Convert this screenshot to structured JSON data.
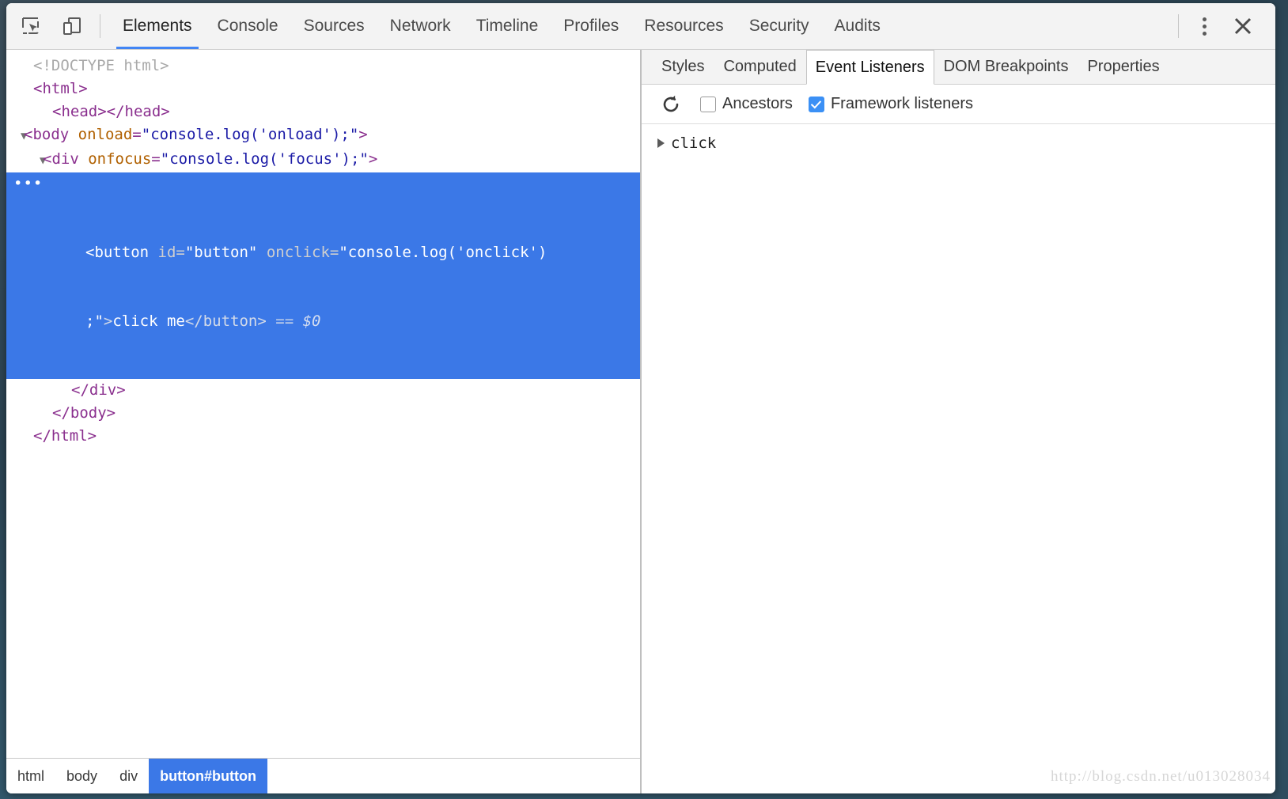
{
  "toolbar": {
    "inspect_icon": "inspect-element-icon",
    "device_icon": "device-toolbar-icon",
    "menu_icon": "more-options-icon",
    "close_icon": "close-icon",
    "tabs": [
      {
        "label": "Elements",
        "active": true
      },
      {
        "label": "Console",
        "active": false
      },
      {
        "label": "Sources",
        "active": false
      },
      {
        "label": "Network",
        "active": false
      },
      {
        "label": "Timeline",
        "active": false
      },
      {
        "label": "Profiles",
        "active": false
      },
      {
        "label": "Resources",
        "active": false
      },
      {
        "label": "Security",
        "active": false
      },
      {
        "label": "Audits",
        "active": false
      }
    ]
  },
  "dom_tree": {
    "rows": {
      "doctype": "<!DOCTYPE html>",
      "html_open": "<html>",
      "head": "<head></head>",
      "body_tag": "<body",
      "body_attr_name": "onload",
      "body_attr_value": "\"console.log('onload');\"",
      "body_close_bracket": ">",
      "div_tag": "<div",
      "div_attr_name": "onfocus",
      "div_attr_value": "\"console.log('focus');\"",
      "div_close_bracket": ">",
      "sel_ellipsis": "•••",
      "sel_button_tag": "<button",
      "sel_id_name": "id=",
      "sel_id_value": "\"button\"",
      "sel_onclick_name": "onclick=",
      "sel_onclick_value_line1": "\"console.log('onclick')",
      "sel_onclick_value_line2": ";\"",
      "sel_gt": ">",
      "sel_text": "click me",
      "sel_close_tag": "</button>",
      "sel_eq": "==",
      "sel_dollar": "$0",
      "div_close": "</div>",
      "body_close": "</body>",
      "html_close": "</html>"
    }
  },
  "breadcrumb": {
    "items": [
      {
        "label": "html",
        "active": false
      },
      {
        "label": "body",
        "active": false
      },
      {
        "label": "div",
        "active": false
      },
      {
        "label": "button#button",
        "active": true
      }
    ]
  },
  "sidebar": {
    "tabs": [
      {
        "label": "Styles",
        "active": false
      },
      {
        "label": "Computed",
        "active": false
      },
      {
        "label": "Event Listeners",
        "active": true
      },
      {
        "label": "DOM Breakpoints",
        "active": false
      },
      {
        "label": "Properties",
        "active": false
      }
    ],
    "toolbar": {
      "refresh_icon": "refresh-icon",
      "ancestors_label": "Ancestors",
      "ancestors_checked": false,
      "framework_label": "Framework listeners",
      "framework_checked": true
    },
    "listeners": [
      {
        "label": "click",
        "expanded": false
      }
    ]
  },
  "watermark": "http://blog.csdn.net/u013028034",
  "colors": {
    "accent_blue": "#4285f4",
    "selection_blue": "#3b78e7",
    "checkbox_blue": "#3b90f5",
    "toolbar_bg": "#f3f3f3",
    "tag_purple": "#8a2f8e",
    "attr_orange": "#b06000",
    "value_blue": "#1a1aa6"
  }
}
